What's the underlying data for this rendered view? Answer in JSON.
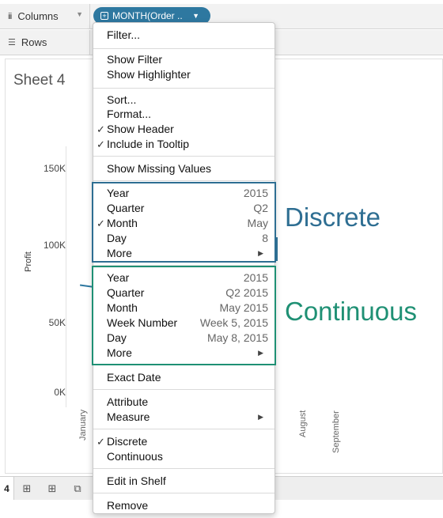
{
  "columns_shelf": {
    "label": "Columns",
    "pill_label": "MONTH(Order .."
  },
  "rows_shelf": {
    "label": "Rows"
  },
  "sheet": {
    "title": "Sheet 4",
    "y_axis_title": "Profit",
    "y_ticks": [
      "150K",
      "100K",
      "50K",
      "0K"
    ],
    "x_labels": [
      "January",
      "August",
      "September"
    ]
  },
  "tabs": {
    "active": "4"
  },
  "menu": {
    "filter": "Filter...",
    "show_filter": "Show Filter",
    "show_highlighter": "Show Highlighter",
    "sort": "Sort...",
    "format": "Format...",
    "show_header": "Show Header",
    "include_tooltip": "Include in Tooltip",
    "show_missing": "Show Missing Values",
    "discrete_items": [
      {
        "label": "Year",
        "value": "2015",
        "checked": false
      },
      {
        "label": "Quarter",
        "value": "Q2",
        "checked": false
      },
      {
        "label": "Month",
        "value": "May",
        "checked": true
      },
      {
        "label": "Day",
        "value": "8",
        "checked": false
      },
      {
        "label": "More",
        "value": "",
        "checked": false
      }
    ],
    "continuous_items": [
      {
        "label": "Year",
        "value": "2015"
      },
      {
        "label": "Quarter",
        "value": "Q2 2015"
      },
      {
        "label": "Month",
        "value": "May 2015"
      },
      {
        "label": "Week Number",
        "value": "Week 5, 2015"
      },
      {
        "label": "Day",
        "value": "May 8, 2015"
      },
      {
        "label": "More",
        "value": ""
      }
    ],
    "exact_date": "Exact Date",
    "attribute": "Attribute",
    "measure": "Measure",
    "discrete": "Discrete",
    "continuous": "Continuous",
    "edit_in_shelf": "Edit in Shelf",
    "remove": "Remove"
  },
  "callouts": {
    "discrete": "Discrete",
    "continuous": "Continuous"
  },
  "colors": {
    "pill": "#2e78a0",
    "discrete": "#2e6e92",
    "continuous": "#1f9074"
  }
}
